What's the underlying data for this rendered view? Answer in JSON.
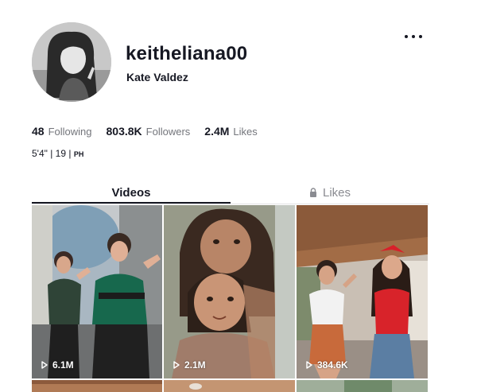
{
  "profile": {
    "username": "keitheliana00",
    "display_name": "Kate Valdez",
    "bio_main": "5'4\" | 19 | ",
    "bio_flag": "PH"
  },
  "stats": [
    {
      "value": "48",
      "label": "Following"
    },
    {
      "value": "803.8K",
      "label": "Followers"
    },
    {
      "value": "2.4M",
      "label": "Likes"
    }
  ],
  "tabs": {
    "videos": "Videos",
    "likes": "Likes"
  },
  "videos": [
    {
      "views": "6.1M"
    },
    {
      "views": "2.1M"
    },
    {
      "views": "384.6K"
    }
  ],
  "icons": {
    "more": "more-options-icon",
    "lock": "lock-icon",
    "play": "play-icon"
  },
  "colors": {
    "text_primary": "#161823",
    "text_secondary": "#73757b",
    "tab_inactive": "#8a8b91"
  }
}
